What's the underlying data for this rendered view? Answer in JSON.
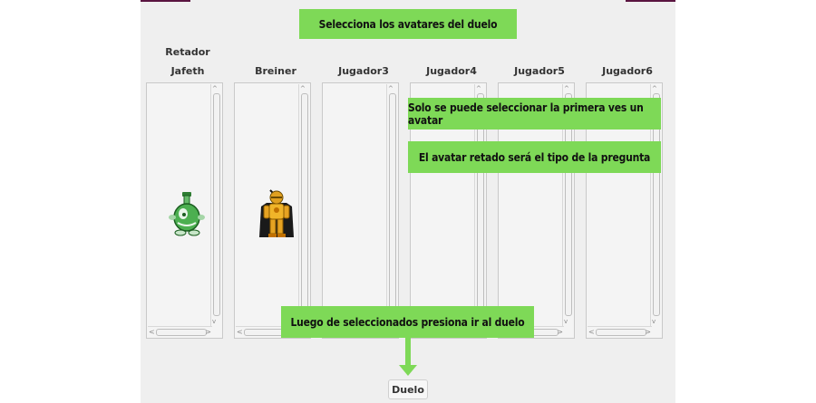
{
  "title_callout": "Selecciona los avatares del duelo",
  "retador_label": "Retador",
  "players": [
    {
      "name": "Jafeth",
      "avatar": "green-potion-creature-icon"
    },
    {
      "name": "Breiner",
      "avatar": "golden-knight-icon"
    },
    {
      "name": "Jugador3",
      "avatar": ""
    },
    {
      "name": "Jugador4",
      "avatar": ""
    },
    {
      "name": "Jugador5",
      "avatar": ""
    },
    {
      "name": "Jugador6",
      "avatar": ""
    }
  ],
  "tips": {
    "tip1": "Solo se puede seleccionar la primera ves un avatar",
    "tip2": "El avatar retado será el tipo de la pregunta",
    "tip3": "Luego de seleccionados presiona ir al duelo"
  },
  "duelo_button": "Duelo",
  "colors": {
    "callout_green": "#7ed957",
    "window_bg": "#efefef",
    "titlebar_accent": "#5a1440"
  }
}
